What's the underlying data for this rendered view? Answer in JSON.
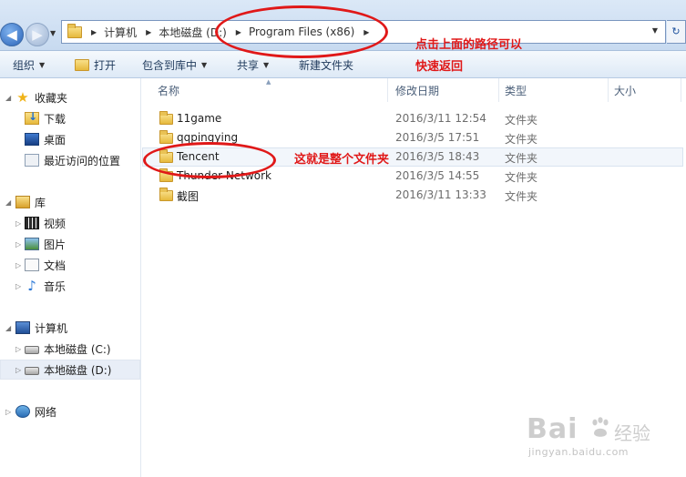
{
  "address_bar": {
    "crumbs": [
      "计算机",
      "本地磁盘 (D:)",
      "Program Files (x86)"
    ]
  },
  "toolbar": {
    "organize": "组织",
    "open": "打开",
    "include_in_library": "包含到库中",
    "share": "共享",
    "new_folder": "新建文件夹"
  },
  "sidebar": {
    "favorites": "收藏夹",
    "downloads": "下载",
    "desktop": "桌面",
    "recent": "最近访问的位置",
    "libraries": "库",
    "videos": "视频",
    "pictures": "图片",
    "documents": "文档",
    "music": "音乐",
    "computer": "计算机",
    "drive_c": "本地磁盘 (C:)",
    "drive_d": "本地磁盘 (D:)",
    "network": "网络"
  },
  "columns": {
    "name": "名称",
    "modified": "修改日期",
    "type": "类型",
    "size": "大小"
  },
  "files": [
    {
      "name": "11game",
      "date": "2016/3/11 12:54",
      "type": "文件夹"
    },
    {
      "name": "qqpingying",
      "date": "2016/3/5 17:51",
      "type": "文件夹"
    },
    {
      "name": "Tencent",
      "date": "2016/3/5 18:43",
      "type": "文件夹"
    },
    {
      "name": "Thunder Network",
      "date": "2016/3/5 14:55",
      "type": "文件夹"
    },
    {
      "name": "截图",
      "date": "2016/3/11 13:33",
      "type": "文件夹"
    }
  ],
  "annotations": {
    "path_note_line1": "点击上面的路径可以",
    "path_note_line2": "快速返回",
    "folder_note": "这就是整个文件夹"
  },
  "watermark": {
    "logo": "Bai",
    "logo_cn": "经验",
    "url": "jingyan.baidu.com"
  },
  "colors": {
    "annotation_red": "#e01818",
    "toolbar_text": "#1e395b"
  }
}
